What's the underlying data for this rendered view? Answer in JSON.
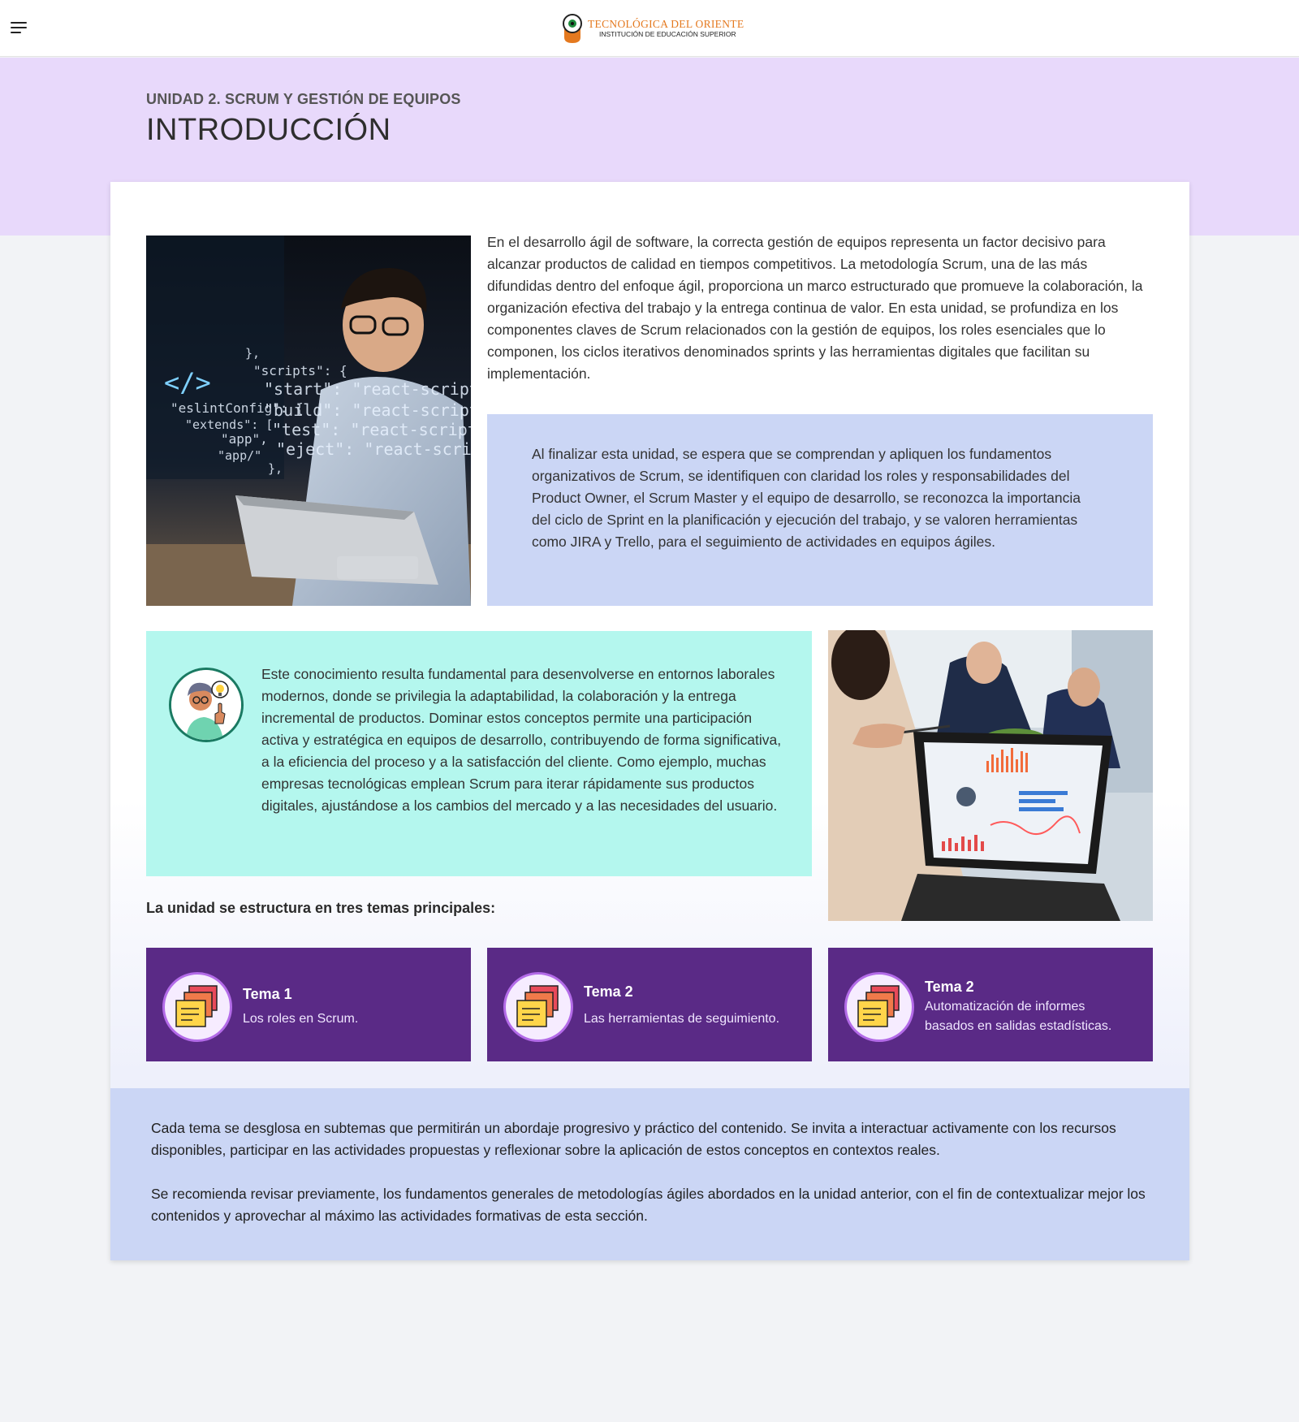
{
  "header": {
    "menu_label": "menu",
    "logo_name": "TECNOLÓGICA DEL ORIENTE",
    "logo_sub": "INSTITUCIÓN DE EDUCACIÓN SUPERIOR"
  },
  "hero": {
    "unit_label": "UNIDAD 2. SCRUM Y GESTIÓN DE EQUIPOS",
    "title": "INTRODUCCIÓN"
  },
  "intro": {
    "paragraph": "En el desarrollo ágil de software, la correcta gestión de equipos representa un factor decisivo para alcanzar productos de calidad en tiempos competitivos. La metodología Scrum, una de las más difundidas dentro del enfoque ágil, proporciona un marco estructurado que promueve la colaboración, la organización efectiva del trabajo y la entrega continua de valor. En esta unidad, se profundiza en los componentes claves de Scrum relacionados con la gestión de equipos, los roles esenciales que lo componen, los ciclos iterativos denominados sprints y las herramientas digitales que facilitan su implementación.",
    "image_code_lines": [
      "},",
      "\"scripts\": {",
      "\"start\": \"react-scripts start\",",
      "\"build\": \"react-scripts build\",",
      "\"test\": \"react-scripts test\",",
      "\"eject\": \"react-scripts eject\"",
      "},",
      "\"eslintConfig\": {",
      "\"extends\": [",
      "\"app\",",
      "\"app/\""
    ],
    "image_code_symbol": "</>"
  },
  "objectives": {
    "paragraph": "Al finalizar esta unidad, se espera que se comprendan y apliquen los fundamentos organizativos de Scrum, se identifiquen con claridad los roles y responsabilidades del Product Owner, el Scrum Master y el equipo de desarrollo, se reconozca la importancia del ciclo de Sprint en la planificación y ejecución del trabajo, y se valoren herramientas como JIRA y Trello, para el seguimiento de actividades en equipos ágiles."
  },
  "context": {
    "paragraph": "Este conocimiento resulta fundamental para desenvolverse en entornos laborales modernos, donde se privilegia la adaptabilidad, la colaboración y la entrega incremental de productos. Dominar estos conceptos permite una participación activa y estratégica en equipos de desarrollo, contribuyendo de forma significativa, a la eficiencia del proceso y a la satisfacción del cliente. Como ejemplo, muchas empresas tecnológicas emplean Scrum para iterar rápidamente sus productos digitales, ajustándose a los cambios del mercado y a las necesidades del usuario."
  },
  "structure": {
    "label": "La unidad se estructura en tres temas principales:",
    "topics": [
      {
        "title": "Tema 1",
        "desc": "Los roles en Scrum."
      },
      {
        "title": "Tema 2",
        "desc": "Las herramientas de seguimiento."
      },
      {
        "title": "Tema 2",
        "desc": "Automatización de informes basados en salidas estadísticas."
      }
    ],
    "topic_icon": "sticky-notes-icon"
  },
  "closing": {
    "paragraph1": "Cada tema se desglosa en subtemas que permitirán un abordaje progresivo y práctico del contenido. Se invita a interactuar activamente con los recursos disponibles, participar en las actividades propuestas y reflexionar sobre la aplicación de estos conceptos en contextos reales.",
    "paragraph2": "Se recomienda revisar previamente, los fundamentos generales de metodologías ágiles abordados en la unidad anterior, con el fin de contextualizar mejor los contenidos y aprovechar al máximo las actividades formativas de esta sección."
  },
  "colors": {
    "hero_bg": "#e8d9fb",
    "objectives_bg": "#cbd6f5",
    "context_bg": "#b4f7ee",
    "topic_bg": "#5a2a86",
    "logo_orange": "#e4791f"
  }
}
